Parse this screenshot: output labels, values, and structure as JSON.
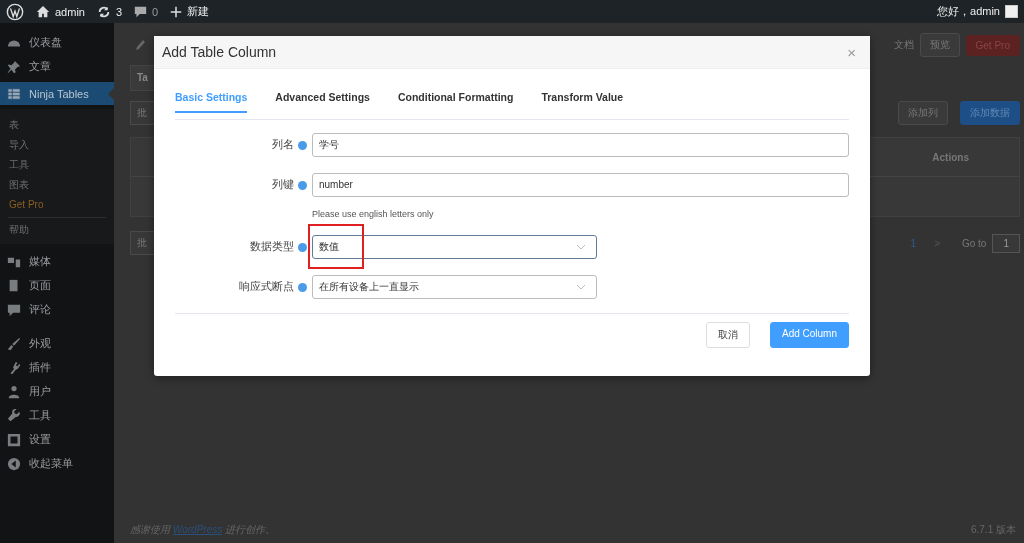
{
  "admin_bar": {
    "items": [
      {
        "kind": "logo"
      },
      {
        "kind": "home",
        "label": "admin"
      },
      {
        "kind": "updates",
        "label": "3"
      },
      {
        "kind": "comments",
        "label": "0"
      },
      {
        "kind": "new",
        "label": "新建"
      }
    ],
    "greeting": "您好，admin"
  },
  "sidebar": {
    "items": [
      {
        "label": "仪表盘",
        "selected": false
      },
      {
        "label": "文章",
        "selected": false
      },
      {
        "label": "Ninja Tables",
        "selected": true,
        "children": [
          {
            "label": "表",
            "kind": "link",
            "selected": false
          },
          {
            "label": "导入",
            "kind": "link",
            "selected": false
          },
          {
            "label": "工具",
            "kind": "link",
            "selected": false
          },
          {
            "label": "图表",
            "kind": "link",
            "selected": false
          },
          {
            "label": "Get Pro",
            "kind": "promo",
            "selected": false
          },
          {
            "label": "帮助",
            "kind": "link",
            "selected": false
          }
        ]
      },
      {
        "label": "媒体",
        "selected": false
      },
      {
        "label": "页面",
        "selected": false
      },
      {
        "label": "评论",
        "selected": false
      },
      {
        "label": "外观",
        "selected": false
      },
      {
        "label": "插件",
        "selected": false
      },
      {
        "label": "用户",
        "selected": false
      },
      {
        "label": "工具",
        "selected": false
      },
      {
        "label": "设置",
        "selected": false
      },
      {
        "label": "收起菜单",
        "selected": false
      }
    ]
  },
  "page": {
    "toolbar": {
      "docs": "文档",
      "preview": "预览",
      "get_pro": "Get Pro"
    },
    "tab": "Ta",
    "bulk_top": "批",
    "add_column": "添加列",
    "add_data": "添加数据",
    "table_header": "Actions",
    "bulk_bottom": "批",
    "pagination": {
      "page": "1",
      "next": ">",
      "goto_label": "Go to",
      "goto_value": "1"
    }
  },
  "dialog": {
    "title": "Add Table Column",
    "close": "×",
    "tabs": [
      {
        "label": "Basic Settings",
        "selected": true
      },
      {
        "label": "Advanced Settings",
        "selected": false
      },
      {
        "label": "Conditional Formatting",
        "selected": false
      },
      {
        "label": "Transform Value",
        "selected": false
      }
    ],
    "fields": [
      {
        "kind": "text",
        "label": "列名",
        "value": "学号"
      },
      {
        "kind": "text",
        "label": "列键",
        "value": "number",
        "hint": "Please use english letters only"
      },
      {
        "kind": "select",
        "label": "数据类型",
        "value": "数值",
        "focused": true,
        "highlighted": true
      },
      {
        "kind": "select",
        "label": "响应式断点",
        "value": "在所有设备上一直显示",
        "focused": false,
        "highlighted": false
      }
    ],
    "buttons": [
      {
        "kind": "secondary",
        "label": "取消"
      },
      {
        "kind": "primary",
        "label": "Add Column"
      }
    ]
  },
  "footer": {
    "thanks_before": "感谢使用 ",
    "link": "WordPress",
    "thanks_after": " 进行创作。",
    "version": "6.7.1 版本"
  }
}
